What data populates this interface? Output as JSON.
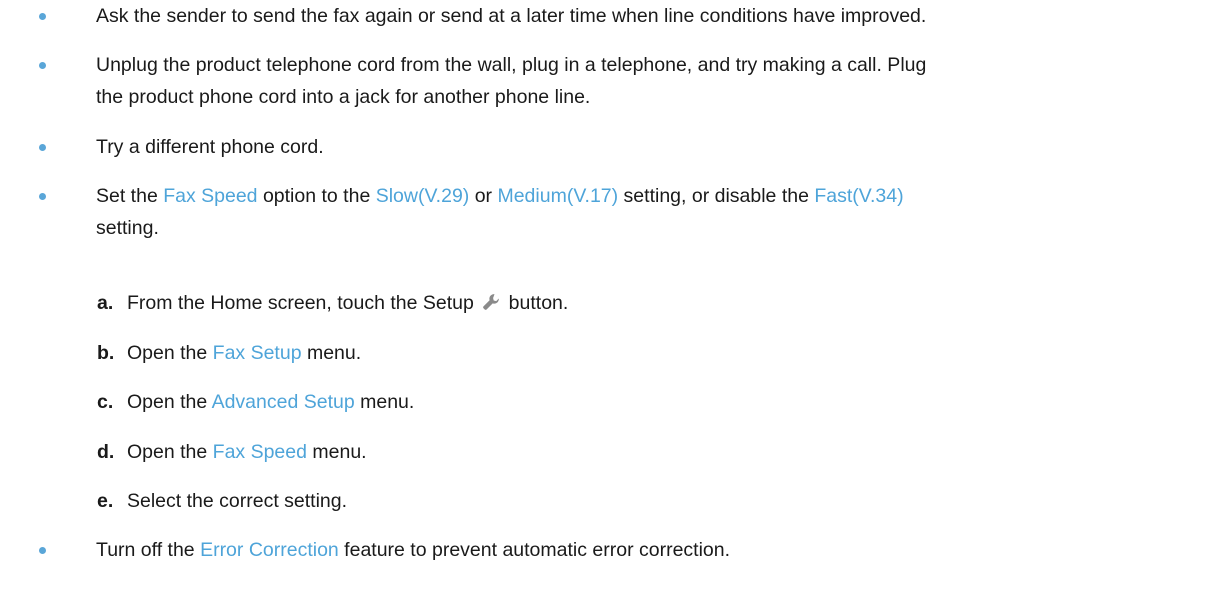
{
  "bullets": [
    {
      "text": "Ask the sender to send the fax again or send at a later time when line conditions have improved."
    },
    {
      "line1": "Unplug the product telephone cord from the wall, plug in a telephone, and try making a call. Plug",
      "line2": "the product phone cord into a jack for another phone line."
    },
    {
      "text": "Try a different phone cord."
    },
    {
      "p1": "Set the ",
      "t1": "Fax Speed",
      "p2": " option to the ",
      "t2": "Slow(V.29)",
      "p3": " or ",
      "t3": "Medium(V.17)",
      "p4": " setting, or disable the ",
      "t4": "Fast(V.34)",
      "p5": "setting."
    },
    {
      "p1": "Turn off the ",
      "t1": "Error Correction",
      "p2": " feature to prevent automatic error correction."
    }
  ],
  "steps": [
    {
      "letter": "a.",
      "pre": "From the Home screen, touch the Setup ",
      "post": " button.",
      "icon": "wrench-icon"
    },
    {
      "letter": "b.",
      "pre": "Open the ",
      "term": "Fax Setup",
      "post": " menu."
    },
    {
      "letter": "c.",
      "pre": "Open the ",
      "term": "Advanced Setup",
      "post": " menu."
    },
    {
      "letter": "d.",
      "pre": "Open the ",
      "term": "Fax Speed",
      "post": " menu."
    },
    {
      "letter": "e.",
      "text": "Select the correct setting."
    }
  ],
  "colors": {
    "term": "#4ea4d9",
    "bullet": "#5aa6d8",
    "text": "#1a1a1a"
  }
}
